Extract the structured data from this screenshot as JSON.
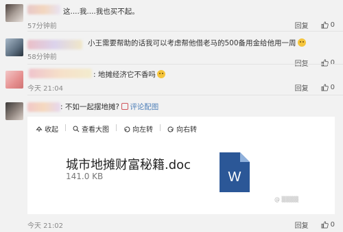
{
  "comments": [
    {
      "text": "这....我....我也买不起。",
      "time": "57分钟前",
      "reply": "回复",
      "likes": "0"
    },
    {
      "text": "小王需要帮助的话我可以考虑帮他借老马的500备用金给他用一周",
      "time": "58分钟前",
      "reply": "回复",
      "likes": "0"
    },
    {
      "text": "地摊经济它不香吗",
      "time": "今天 21:04",
      "reply": "回复",
      "likes": "0"
    },
    {
      "text": "不如一起摆地摊?",
      "comment_pic": "评论配图",
      "time": "今天 21:02",
      "reply": "回复",
      "likes": "0"
    }
  ],
  "image_viewer": {
    "toolbar": [
      "收起",
      "查看大图",
      "向左转",
      "向右转"
    ],
    "doc_title": "城市地摊财富秘籍.doc",
    "doc_size": "141.0 KB",
    "doc_icon_letter": "W",
    "icon_name": "word-document-icon",
    "accent_color": "#2b5797"
  },
  "colors": {
    "background": "#f2f2f2",
    "link": "#4d7fb8",
    "word_blue": "#2b5797"
  }
}
